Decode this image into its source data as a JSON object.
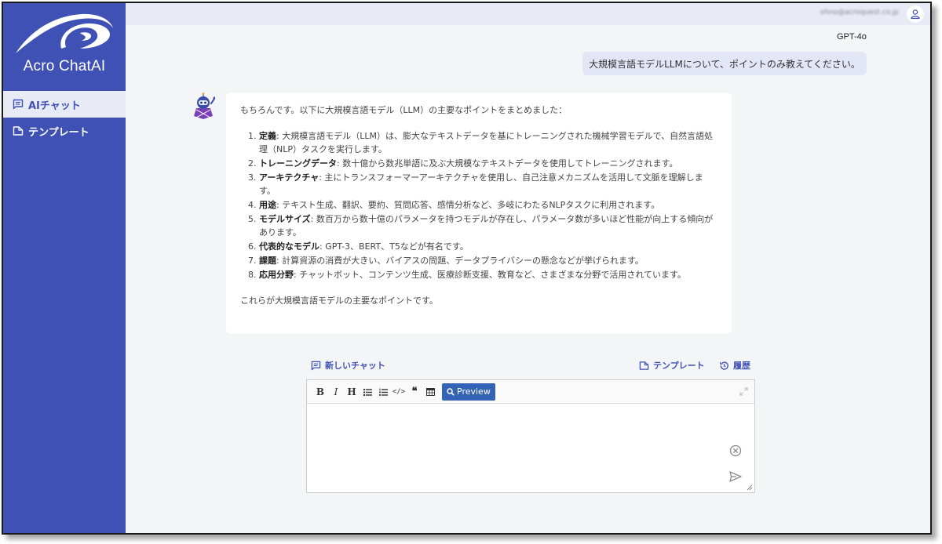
{
  "sidebar": {
    "app_name": "Acro ChatAI",
    "items": [
      {
        "label": "AIチャット",
        "icon": "chat-icon",
        "active": true
      },
      {
        "label": "テンプレート",
        "icon": "template-icon",
        "active": false
      }
    ]
  },
  "topbar": {
    "user_email": "ohno@acroquest.co.jp"
  },
  "model": "GPT-4o",
  "user_message": "大規模言語モデルLLMについて、ポイントのみ教えてください。",
  "assistant": {
    "intro": "もちろんです。以下に大規模言語モデル（LLM）の主要なポイントをまとめました：",
    "points": [
      {
        "num": "1.",
        "term": "定義",
        "text": ": 大規模言語モデル（LLM）は、膨大なテキストデータを基にトレーニングされた機械学習モデルで、自然言語処理（NLP）タスクを実行します。"
      },
      {
        "num": "2.",
        "term": "トレーニングデータ",
        "text": ": 数十億から数兆単語に及ぶ大規模なテキストデータを使用してトレーニングされます。"
      },
      {
        "num": "3.",
        "term": "アーキテクチャ",
        "text": ": 主にトランスフォーマーアーキテクチャを使用し、自己注意メカニズムを活用して文脈を理解します。"
      },
      {
        "num": "4.",
        "term": "用途",
        "text": ": テキスト生成、翻訳、要約、質問応答、感情分析など、多岐にわたるNLPタスクに利用されます。"
      },
      {
        "num": "5.",
        "term": "モデルサイズ",
        "text": ": 数百万から数十億のパラメータを持つモデルが存在し、パラメータ数が多いほど性能が向上する傾向があります。"
      },
      {
        "num": "6.",
        "term": "代表的なモデル",
        "text": ": GPT-3、BERT、T5などが有名です。"
      },
      {
        "num": "7.",
        "term": "課題",
        "text": ": 計算資源の消費が大きい、バイアスの問題、データプライバシーの懸念などが挙げられます。"
      },
      {
        "num": "8.",
        "term": "応用分野",
        "text": ": チャットボット、コンテンツ生成、医療診断支援、教育など、さまざまな分野で活用されています。"
      }
    ],
    "outro": "これらが大規模言語モデルの主要なポイントです。"
  },
  "actions": {
    "new_chat": "新しいチャット",
    "template": "テンプレート",
    "history": "履歴"
  },
  "editor": {
    "toolbar": {
      "bold": "B",
      "italic": "I",
      "heading": "H",
      "code": "</>",
      "quote": "❝",
      "preview": "Preview"
    },
    "value": ""
  },
  "colors": {
    "sidebar_bg": "#3f51b5",
    "active_item_bg": "#e8eaf6",
    "user_bubble": "#e3e6f6",
    "preview_button": "#3462b4"
  }
}
